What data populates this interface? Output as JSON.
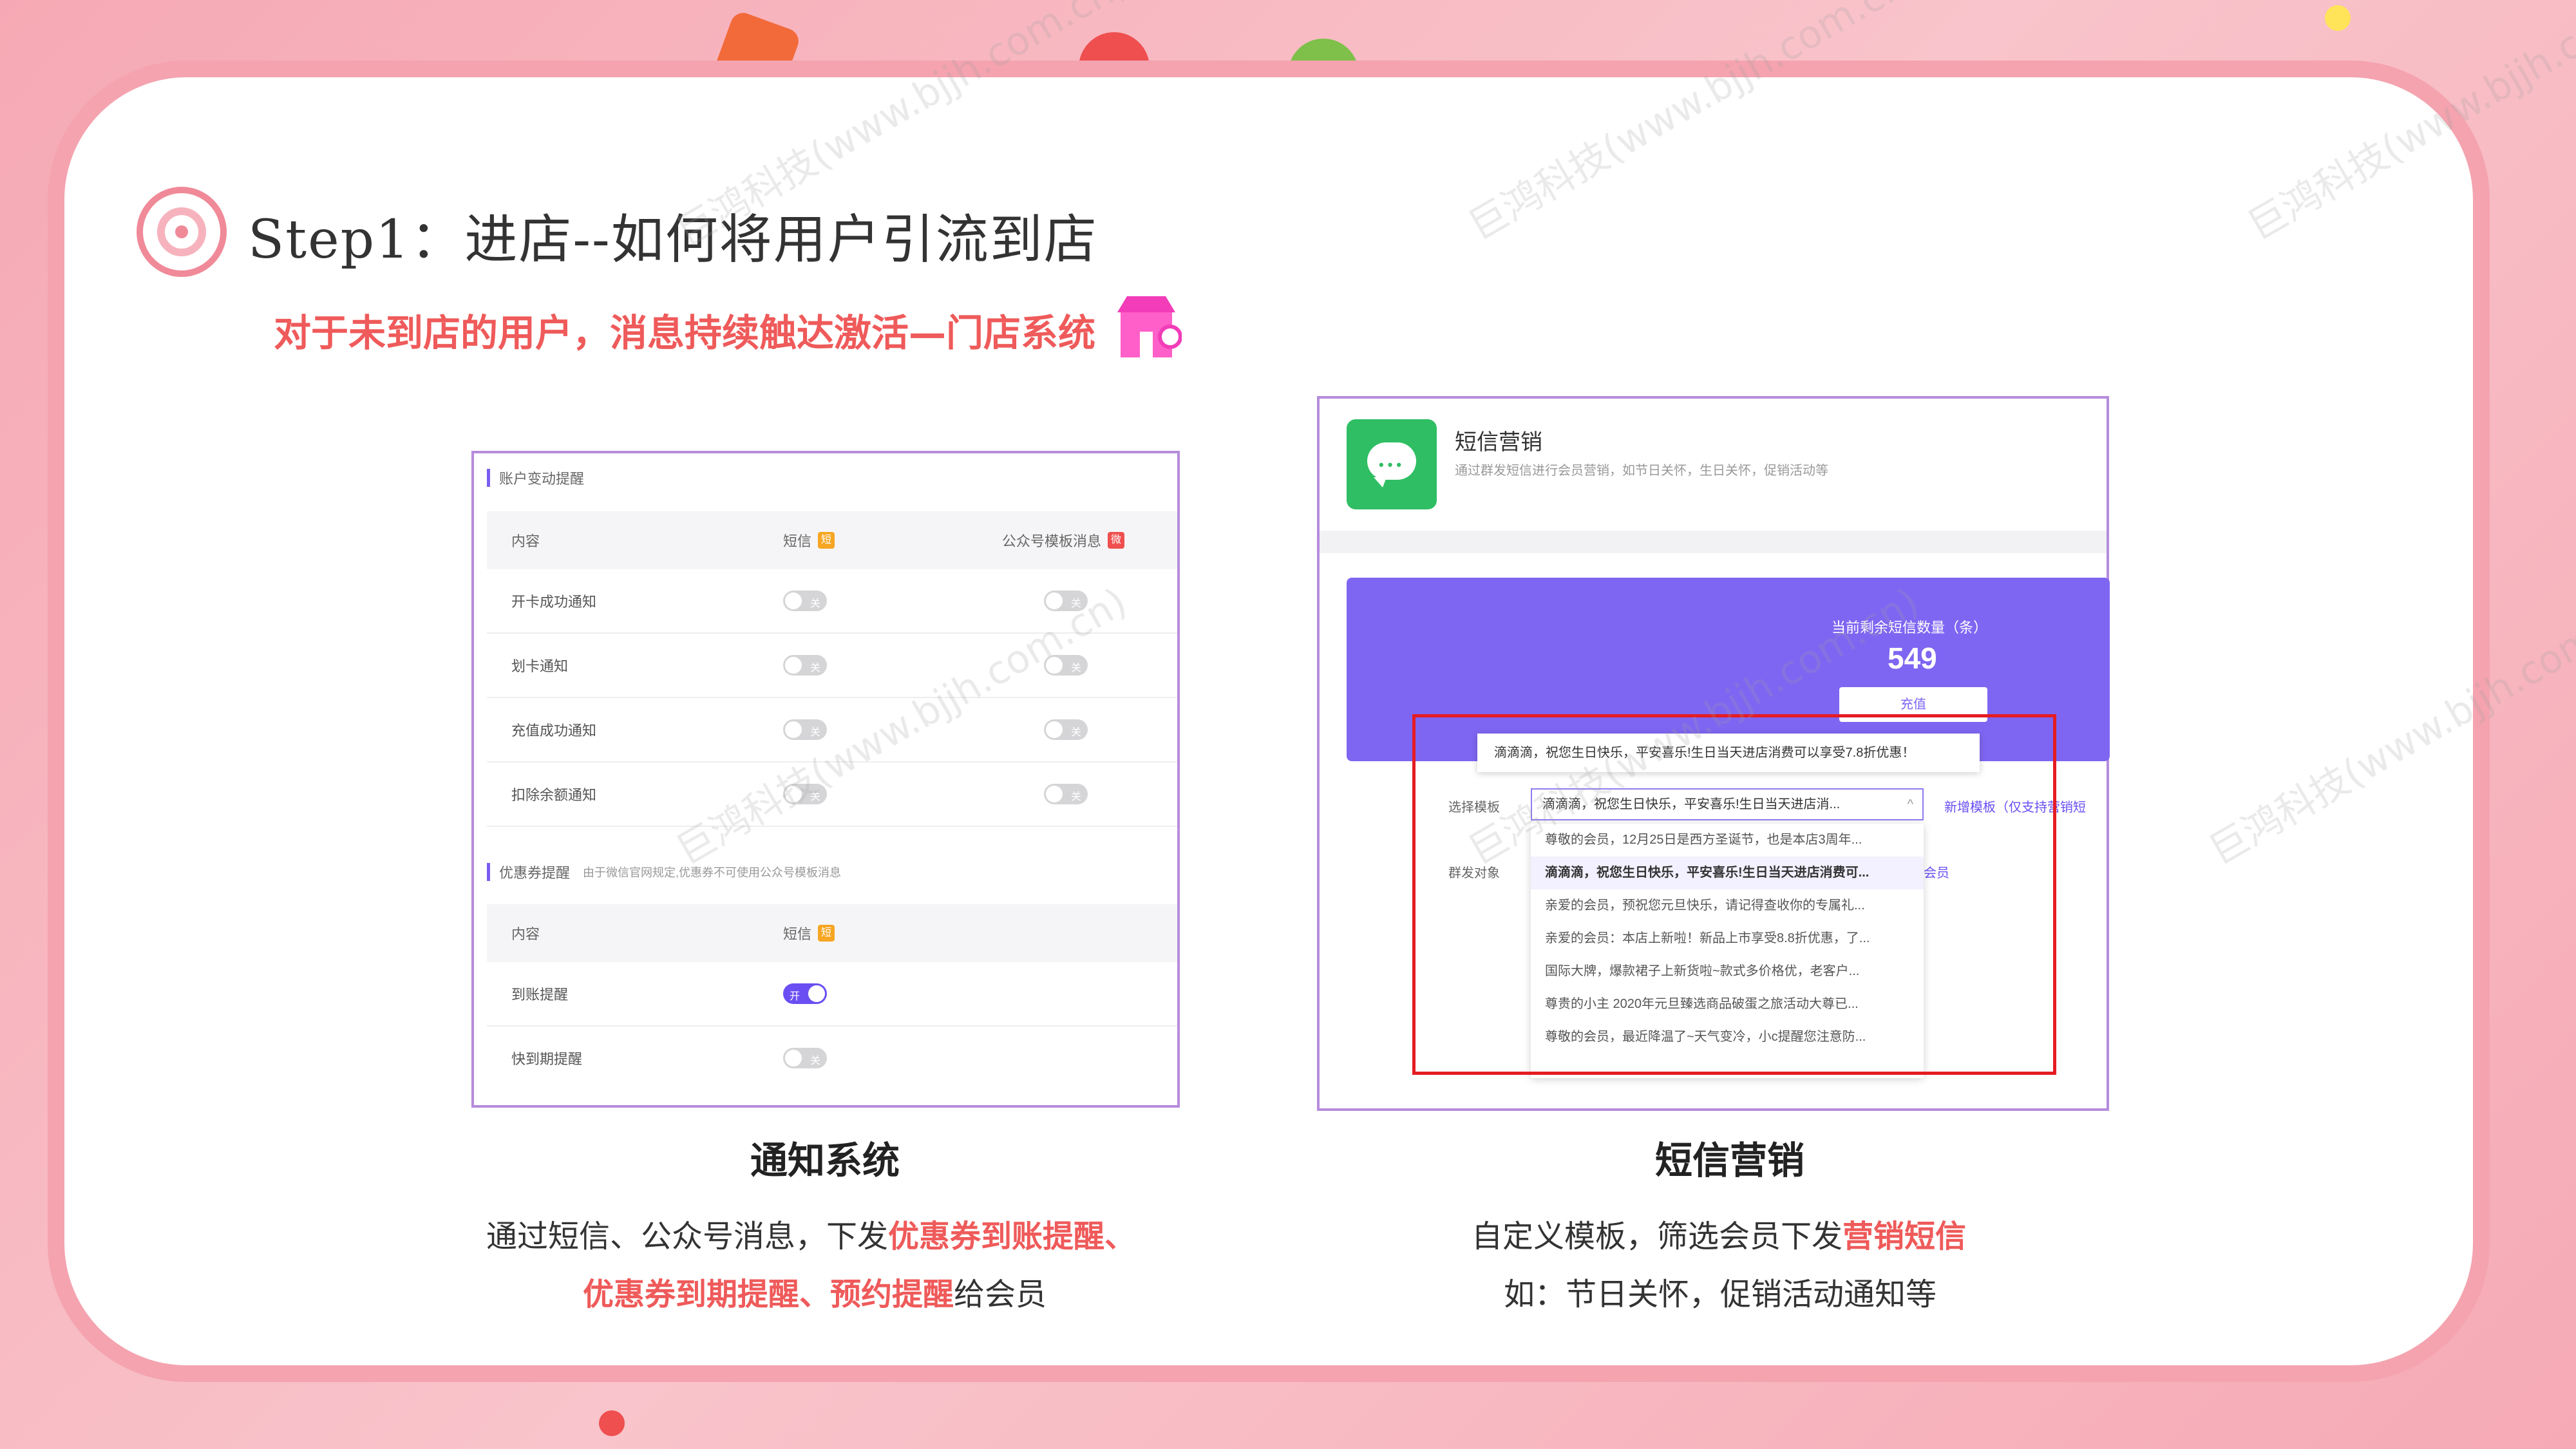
{
  "header": {
    "title": "Step1：进店--如何将用户引流到店",
    "subtitle": "对于未到店的用户，消息持续触达激活—门店系统"
  },
  "left_panel": {
    "section1": {
      "title": "账户变动提醒",
      "columns": [
        "内容",
        "短信",
        "公众号模板消息"
      ],
      "rows": [
        {
          "label": "开卡成功通知",
          "sms": "关",
          "wechat": "关"
        },
        {
          "label": "划卡通知",
          "sms": "关",
          "wechat": "关"
        },
        {
          "label": "充值成功通知",
          "sms": "关",
          "wechat": "关"
        },
        {
          "label": "扣除余额通知",
          "sms": "关",
          "wechat": "关"
        }
      ]
    },
    "section2": {
      "title": "优惠券提醒",
      "note": "由于微信官网规定,优惠券不可使用公众号模板消息",
      "columns": [
        "内容",
        "短信"
      ],
      "rows": [
        {
          "label": "到账提醒",
          "sms": "开",
          "on": true
        },
        {
          "label": "快到期提醒",
          "sms": "关",
          "on": false
        }
      ]
    },
    "sms_tag": "短",
    "wechat_tag": "微",
    "caption": {
      "title": "通知系统",
      "line1_prefix": "通过短信、公众号消息，下发",
      "line1_hl": "优惠券到账提醒、",
      "line2_hl": "优惠券到期提醒、预约提醒",
      "line2_suffix": "给会员"
    }
  },
  "right_panel": {
    "name": "短信营销",
    "desc": "通过群发短信进行会员营销，如节日关怀，生日关怀，促销活动等",
    "remaining_label": "当前剩余短信数量（条）",
    "remaining_count": "549",
    "recharge": "充值",
    "preview": "滴滴滴，祝您生日快乐，平安喜乐!生日当天进店消费可以享受7.8折优惠！",
    "select_label": "选择模板",
    "select_value": "滴滴滴，祝您生日快乐，平安喜乐!生日当天进店消...",
    "new_template": "新增模板（仅支持营销短",
    "target_label": "群发对象",
    "member_link": "会员",
    "options": [
      "尊敬的会员，12月25日是西方圣诞节，也是本店3周年...",
      "滴滴滴，祝您生日快乐，平安喜乐!生日当天进店消费可...",
      "亲爱的会员，预祝您元旦快乐，请记得查收你的专属礼...",
      "亲爱的会员：本店上新啦！新品上市享受8.8折优惠，了...",
      "国际大牌，爆款裙子上新货啦~款式多价格优，老客户...",
      "尊贵的小主 2020年元旦臻选商品破蛋之旅活动大尊已...",
      "尊敬的会员，最近降温了~天气变冷，小c提醒您注意防..."
    ],
    "selected_index": 1,
    "caption": {
      "title": "短信营销",
      "line1_prefix": "自定义模板，筛选会员下发",
      "line1_hl": "营销短信",
      "line2": "如：节日关怀，促销活动通知等"
    }
  },
  "watermark": "巨鸿科技(www.bjjh.com.cn)",
  "colors": {
    "accent": "#ef5a5a",
    "purple": "#7f66f2",
    "card_border": "#f4a3af",
    "red_box": "#e51c23"
  }
}
